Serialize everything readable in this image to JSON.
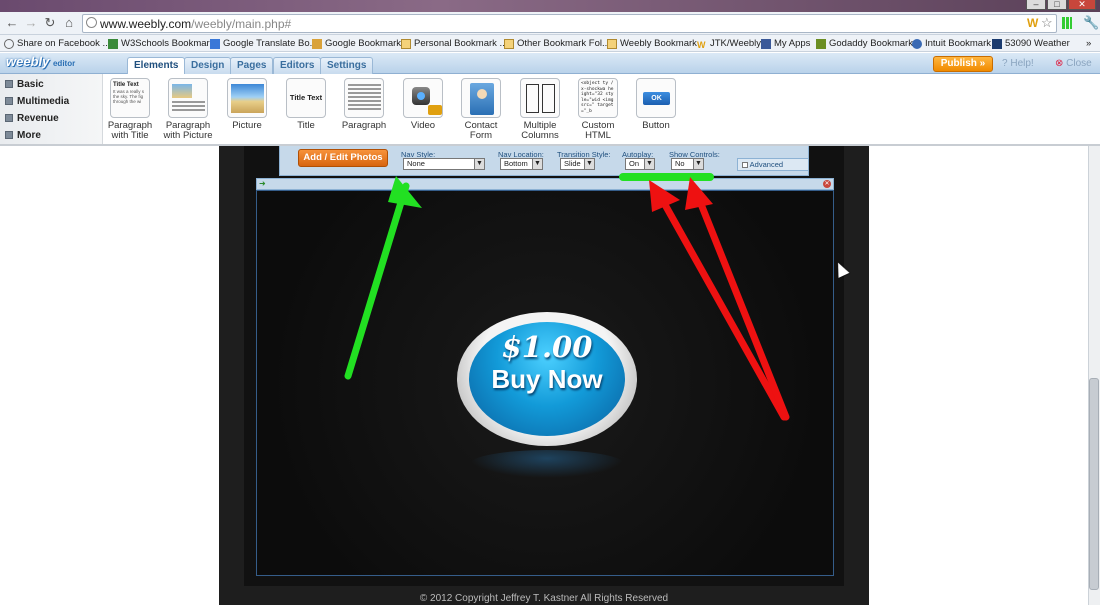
{
  "browser": {
    "url_host": "www.weebly.com",
    "url_path": "/weebly/main.php#",
    "bookmarks": [
      "Share on Facebook ...",
      "W3Schools Bookmark",
      "Google Translate Bo...",
      "Google Bookmark",
      "Personal Bookmark ...",
      "Other Bookmark Fol...",
      "Weebly Bookmark",
      "JTK/Weebly",
      "My Apps",
      "Godaddy Bookmark",
      "Intuit Bookmark",
      "53090 Weather"
    ],
    "overflow": "»"
  },
  "weebly": {
    "logo": "weebly",
    "logo_sub": "editor",
    "logo_pro": "pro",
    "tabs": [
      "Elements",
      "Design",
      "Pages",
      "Editors",
      "Settings"
    ],
    "active_tab": "Elements",
    "publish": "Publish »",
    "help": "Help!",
    "close": "Close"
  },
  "categories": [
    "Basic",
    "Multimedia",
    "Revenue",
    "More"
  ],
  "elements": [
    {
      "label1": "Paragraph",
      "label2": "with Title"
    },
    {
      "label1": "Paragraph",
      "label2": "with Picture"
    },
    {
      "label1": "Picture",
      "label2": ""
    },
    {
      "label1": "Title",
      "label2": ""
    },
    {
      "label1": "Paragraph",
      "label2": ""
    },
    {
      "label1": "Video",
      "label2": ""
    },
    {
      "label1": "Contact",
      "label2": "Form"
    },
    {
      "label1": "Multiple",
      "label2": "Columns"
    },
    {
      "label1": "Custom",
      "label2": "HTML"
    },
    {
      "label1": "Button",
      "label2": ""
    }
  ],
  "element_thumbs": {
    "para_title": "Title Text",
    "para_title_body": "It was a really s the sky. The fig through the wi",
    "title_text": "Title Text",
    "html_code": "<object ty /x-shockwa height=\"32 style=\"wid <img src=\" target=\"_b",
    "ok": "OK"
  },
  "slideshow": {
    "add_edit": "Add / Edit Photos",
    "nav_style_label": "Nav Style:",
    "nav_style_value": "None",
    "nav_location_label": "Nav Location:",
    "nav_location_value": "Bottom",
    "transition_label": "Transition Style:",
    "transition_value": "Slide",
    "autoplay_label": "Autoplay:",
    "autoplay_value": "On",
    "show_controls_label": "Show Controls:",
    "show_controls_value": "No",
    "advanced": "Advanced"
  },
  "buy_button": {
    "price": "$1.00",
    "label": "Buy Now"
  },
  "footer": "© 2012 Copyright Jeffrey T. Kastner All Rights Reserved",
  "colors": {
    "annotation_green": "#22e022",
    "annotation_red": "#ee1111",
    "accent_orange": "#f08a00",
    "button_blue": "#129ad8"
  }
}
